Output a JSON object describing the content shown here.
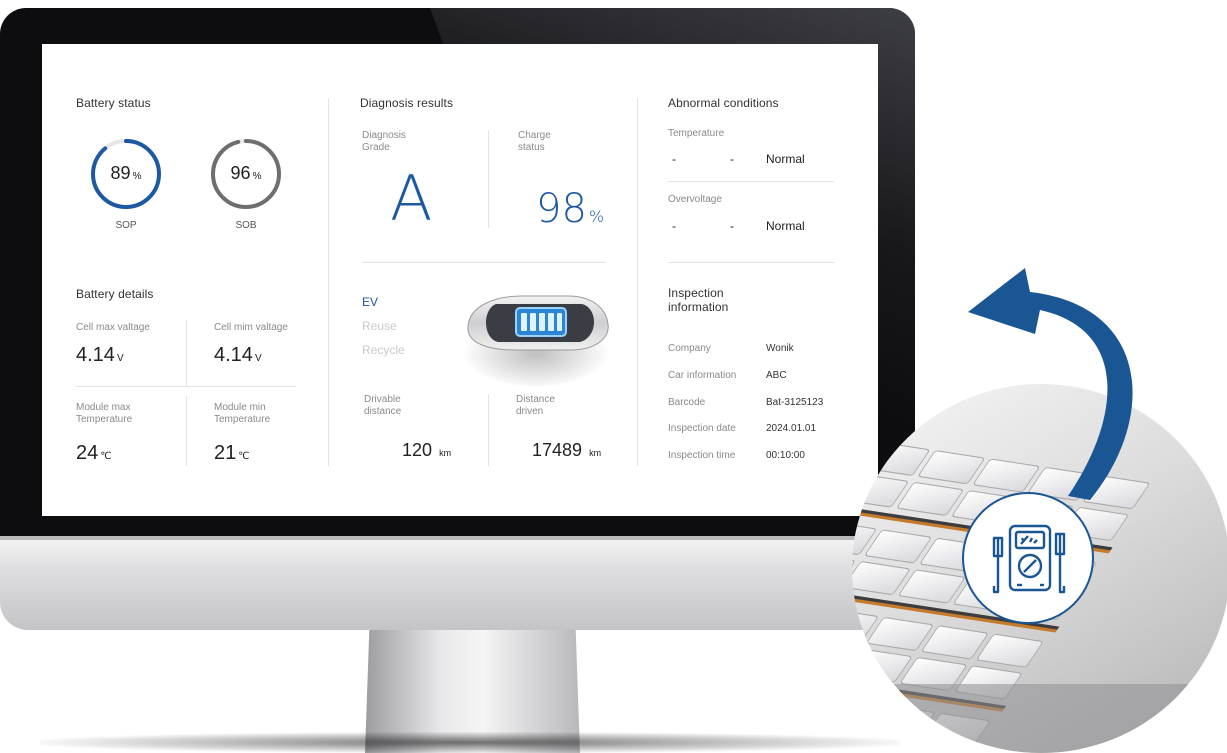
{
  "battery_status": {
    "title": "Battery status",
    "gauges": [
      {
        "value": "89",
        "unit": "%",
        "label": "SOP",
        "color": "#1d58a3",
        "fraction": 0.89
      },
      {
        "value": "96",
        "unit": "%",
        "label": "SOB",
        "color": "#6e6e6e",
        "fraction": 0.96
      }
    ]
  },
  "battery_details": {
    "title": "Battery details",
    "items": [
      {
        "label": "Cell max valtage",
        "value": "4.14",
        "unit": "V"
      },
      {
        "label": "Cell mim valtage",
        "value": "4.14",
        "unit": "V"
      },
      {
        "label": "Module max Temperature",
        "value": "24",
        "unit": "℃"
      },
      {
        "label": "Module min Temperature",
        "value": "21",
        "unit": "℃"
      }
    ]
  },
  "diagnosis": {
    "title": "Diagnosis results",
    "grade_label": "Diagnosis Grade",
    "grade": "A",
    "charge_label": "Charge status",
    "charge_value": "98",
    "charge_unit": "%",
    "usage_options": [
      "EV",
      "Reuse",
      "Recycle"
    ],
    "selected_usage": "EV",
    "drivable_label": "Drivable distance",
    "drivable_value": "120",
    "drivable_unit": "km",
    "driven_label": "Distance driven",
    "driven_value": "17489",
    "driven_unit": "km"
  },
  "abnormal": {
    "title": "Abnormal conditions",
    "rows": [
      {
        "label": "Temperature",
        "dash1": "-",
        "dash2": "-",
        "status": "Normal"
      },
      {
        "label": "Overvoltage",
        "dash1": "-",
        "dash2": "-",
        "status": "Normal"
      }
    ]
  },
  "inspection": {
    "title": "Inspection information",
    "rows": [
      {
        "label": "Company",
        "value": "Wonik"
      },
      {
        "label": "Car information",
        "value": "ABC"
      },
      {
        "label": "Barcode",
        "value": "Bat-3125123"
      },
      {
        "label": "Inspection date",
        "value": "2024.01.01"
      },
      {
        "label": "Inspection time",
        "value": "00:10:00"
      }
    ]
  },
  "colors": {
    "accent": "#1d58a3",
    "arrow": "#1b5694",
    "muted_text": "#8a8a8a"
  },
  "icons": {
    "car": "car-top-view-icon",
    "battery": "battery-icon",
    "multimeter": "multimeter-icon",
    "arrow": "curved-arrow-icon"
  }
}
